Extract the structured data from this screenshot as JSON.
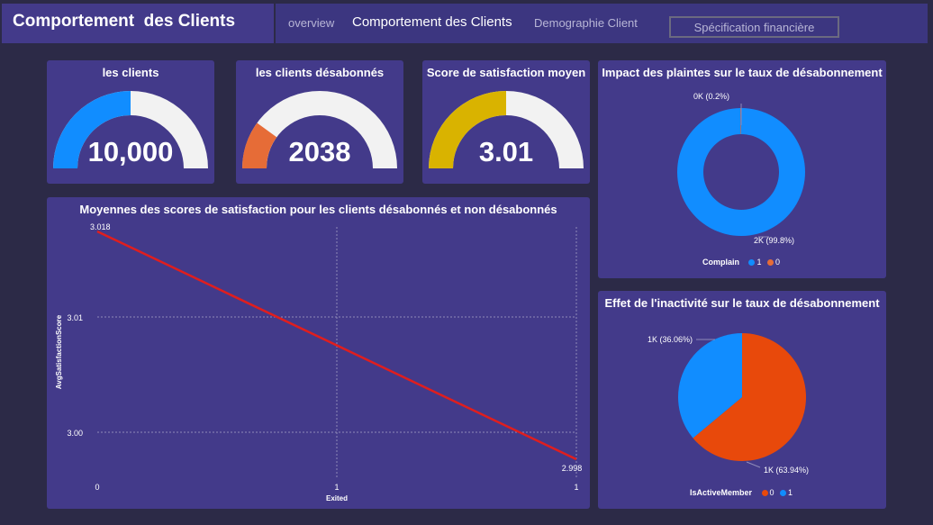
{
  "header": {
    "title": "Comportement  des Clients",
    "tabs": [
      {
        "label": "overview"
      },
      {
        "label": "Comportement des Clients"
      },
      {
        "label": "Demographie Client"
      },
      {
        "label": "Spécification financière"
      }
    ]
  },
  "colors": {
    "background": "#2c2a47",
    "card": "#433a8a",
    "blue": "#118dff",
    "orange": "#e66c37",
    "gold": "#d9b300",
    "line_red": "#e01e1e",
    "gauge_track": "#f2f2f2",
    "pie_orange": "#e8490b"
  },
  "kpis": [
    {
      "title": "les clients",
      "value": "10,000",
      "fraction": 0.5,
      "color": "#118dff"
    },
    {
      "title": "les clients désabonnés",
      "value": "2038",
      "fraction": 0.2,
      "color": "#e66c37"
    },
    {
      "title": "Score de satisfaction moyen",
      "value": "3.01",
      "fraction": 0.5,
      "color": "#d9b300"
    }
  ],
  "chart_data": [
    {
      "type": "line",
      "title": "Moyennes des scores de satisfaction pour les clients désabonnés et non désabonnés",
      "xlabel": "Exited",
      "ylabel": "AvgSatisfactionScore",
      "x": [
        0,
        1
      ],
      "x_ticks": [
        "0",
        "1",
        "1"
      ],
      "y_ticks": [
        "3.01",
        "3.00"
      ],
      "ylim": [
        2.998,
        3.018
      ],
      "series": [
        {
          "values": [
            3.018,
            2.998
          ],
          "labels": [
            "3.018",
            "2.998"
          ]
        }
      ],
      "grid": true
    },
    {
      "type": "pie",
      "title": "Impact des plaintes sur le taux de désabonnement",
      "donut": true,
      "legend_title": "Complain",
      "legend": [
        "1",
        "0"
      ],
      "slices": [
        {
          "label": "1",
          "value": 99.8,
          "text": "2K (99.8%)",
          "color": "#118dff"
        },
        {
          "label": "0",
          "value": 0.2,
          "text": "0K (0.2%)",
          "color": "#e66c37"
        }
      ]
    },
    {
      "type": "pie",
      "title": "Effet de l'inactivité sur le taux de désabonnement",
      "donut": false,
      "legend_title": "IsActiveMember",
      "legend": [
        "0",
        "1"
      ],
      "slices": [
        {
          "label": "0",
          "value": 63.94,
          "text": "1K (63.94%)",
          "color": "#e8490b"
        },
        {
          "label": "1",
          "value": 36.06,
          "text": "1K (36.06%)",
          "color": "#118dff"
        }
      ]
    }
  ]
}
